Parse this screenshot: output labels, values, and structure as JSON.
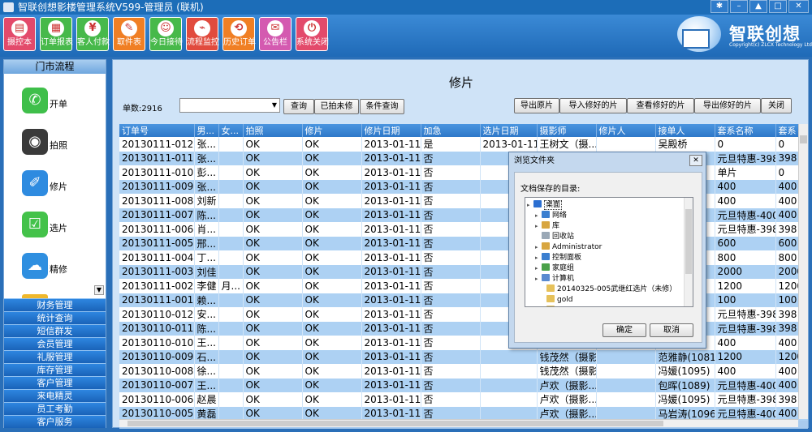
{
  "window": {
    "title": "智联创想影楼管理系统V599-管理员 (联机)",
    "controls": [
      "gear-icon",
      "minimize-icon",
      "shirt-icon",
      "restore-icon",
      "close-icon"
    ]
  },
  "toolbar": {
    "buttons": [
      {
        "label": "摄控本",
        "icon": "camera-book-icon",
        "color": "#e34a6b"
      },
      {
        "label": "订单报表",
        "icon": "report-icon",
        "color": "#47b94a"
      },
      {
        "label": "客人付款",
        "icon": "payment-icon",
        "color": "#47b94a"
      },
      {
        "label": "取件表",
        "icon": "pickup-icon",
        "color": "#f07f24"
      },
      {
        "label": "今日接待",
        "icon": "reception-icon",
        "color": "#47b94a"
      },
      {
        "label": "流程监控",
        "icon": "monitor-icon",
        "color": "#e14b3e"
      },
      {
        "label": "历史订单",
        "icon": "history-icon",
        "color": "#f07f24"
      },
      {
        "label": "公告栏",
        "icon": "notice-icon",
        "color": "#d45ab0"
      },
      {
        "label": "系统关闭",
        "icon": "shutdown-icon",
        "color": "#e34a6b"
      }
    ]
  },
  "brand": {
    "name": "智联创想",
    "subtitle": "Copyright(c) ZLCX Technology Ltd"
  },
  "sidebar": {
    "section_title": "门市流程",
    "tiles": [
      {
        "label": "开单",
        "icon": "phone-icon",
        "color": "#3fbf4a"
      },
      {
        "label": "拍照",
        "icon": "camera-icon",
        "color": "#3a3a3a"
      },
      {
        "label": "修片",
        "icon": "edit-photo-icon",
        "color": "#2e8be0"
      },
      {
        "label": "选片",
        "icon": "select-photo-icon",
        "color": "#44c24a"
      },
      {
        "label": "精修",
        "icon": "weather-icon",
        "color": "#2f8fe0"
      }
    ],
    "menu": [
      "财务管理",
      "统计查询",
      "短信群发",
      "会员管理",
      "礼服管理",
      "库存管理",
      "客户管理",
      "来电精灵",
      "员工考勤",
      "客户服务"
    ]
  },
  "main": {
    "title": "修片",
    "count_label": "单数:2916",
    "filter_value": "",
    "buttons": {
      "query": "查询",
      "shot_not_retouched": "已拍未修",
      "conditional_query": "条件查询",
      "export_originals": "导出原片",
      "import_retouched": "导入修好的片",
      "view_retouched": "查看修好的片",
      "export_retouched": "导出修好的片",
      "close": "关闭"
    }
  },
  "table": {
    "columns": [
      "订单号",
      "男...",
      "女...",
      "拍照",
      "修片",
      "修片日期",
      "加急",
      "选片日期",
      "摄影师",
      "修片人",
      "接单人",
      "套系名称",
      "套系"
    ],
    "rows": [
      [
        "20130111-012",
        "张...",
        "",
        "OK",
        "OK",
        "2013-01-11",
        "是",
        "2013-01-11",
        "王树文（摄...",
        "",
        "吴殿桥",
        "0",
        "0"
      ],
      [
        "20130111-011",
        "张...",
        "",
        "OK",
        "OK",
        "2013-01-11",
        "否",
        "",
        "",
        "",
        "",
        "元旦特惠-398",
        "398"
      ],
      [
        "20130111-010",
        "彭...",
        "",
        "OK",
        "OK",
        "2013-01-11",
        "否",
        "",
        "",
        "",
        "",
        "单片",
        "0"
      ],
      [
        "20130111-009",
        "张...",
        "",
        "OK",
        "OK",
        "2013-01-11",
        "否",
        "",
        "",
        "",
        "",
        "400",
        "400"
      ],
      [
        "20130111-008",
        "刘新",
        "",
        "OK",
        "OK",
        "2013-01-11",
        "否",
        "",
        "",
        "",
        "",
        "400",
        "400"
      ],
      [
        "20130111-007",
        "陈...",
        "",
        "OK",
        "OK",
        "2013-01-11",
        "否",
        "",
        "",
        "",
        "1)",
        "元旦特惠-400",
        "400"
      ],
      [
        "20130111-006",
        "肖...",
        "",
        "OK",
        "OK",
        "2013-01-11",
        "否",
        "",
        "",
        "",
        "2)",
        "元旦特惠-398",
        "398"
      ],
      [
        "20130111-005",
        "邢...",
        "",
        "OK",
        "OK",
        "2013-01-11",
        "否",
        "",
        "",
        "",
        "2)",
        "600",
        "600"
      ],
      [
        "20130111-004",
        "丁...",
        "",
        "OK",
        "OK",
        "2013-01-11",
        "否",
        "",
        "",
        "",
        "5)",
        "800",
        "800"
      ],
      [
        "20130111-003",
        "刘佳",
        "",
        "OK",
        "OK",
        "2013-01-11",
        "否",
        "",
        "",
        "",
        "",
        "2000",
        "2000"
      ],
      [
        "20130111-002",
        "李健",
        "月...",
        "OK",
        "OK",
        "2013-01-11",
        "否",
        "",
        "",
        "",
        "",
        "1200",
        "1200"
      ],
      [
        "20130111-001",
        "赖...",
        "",
        "OK",
        "OK",
        "2013-01-11",
        "否",
        "",
        "",
        "",
        "5)",
        "100",
        "100"
      ],
      [
        "20130110-012",
        "安...",
        "",
        "OK",
        "OK",
        "2013-01-11",
        "否",
        "",
        "",
        "",
        "5)",
        "元旦特惠-398",
        "398"
      ],
      [
        "20130110-011",
        "陈...",
        "",
        "OK",
        "OK",
        "2013-01-11",
        "否",
        "",
        "",
        "",
        "2)",
        "元旦特惠-398",
        "398"
      ],
      [
        "20130110-010",
        "王...",
        "",
        "OK",
        "OK",
        "2013-01-11",
        "否",
        "",
        "",
        "",
        "",
        "400",
        "400"
      ],
      [
        "20130110-009",
        "石...",
        "",
        "OK",
        "OK",
        "2013-01-11",
        "否",
        "",
        "钱茂然（摄影...",
        "",
        "范雅静(1081)",
        "1200",
        "1200"
      ],
      [
        "20130110-008",
        "徐...",
        "",
        "OK",
        "OK",
        "2013-01-11",
        "否",
        "",
        "钱茂然（摄影...",
        "",
        "冯媛(1095)",
        "400",
        "400"
      ],
      [
        "20130110-007",
        "王...",
        "",
        "OK",
        "OK",
        "2013-01-11",
        "否",
        "",
        "卢欢（摄影...",
        "",
        "包晖(1089)",
        "元旦特惠-400",
        "400"
      ],
      [
        "20130110-006",
        "赵晨",
        "",
        "OK",
        "OK",
        "2013-01-11",
        "否",
        "",
        "卢欢（摄影...",
        "",
        "冯媛(1095)",
        "元旦特惠-398",
        "398"
      ],
      [
        "20130110-005",
        "黄磊",
        "",
        "OK",
        "OK",
        "2013-01-11",
        "否",
        "",
        "卢欢（摄影...",
        "",
        "马岩涛(1096)",
        "元旦特惠-400",
        "400"
      ]
    ]
  },
  "dialog": {
    "title": "浏览文件夹",
    "prompt": "文档保存的目录:",
    "tree": [
      {
        "label": "桌面",
        "icon": "desktop-icon",
        "color": "#2c6fd1",
        "selected": true
      },
      {
        "label": "网络",
        "icon": "network-icon",
        "color": "#3b7fd0"
      },
      {
        "label": "库",
        "icon": "library-icon",
        "color": "#d8a640"
      },
      {
        "label": "回收站",
        "icon": "recycle-bin-icon",
        "color": "#9aa8b6"
      },
      {
        "label": "Administrator",
        "icon": "user-folder-icon",
        "color": "#d8a640"
      },
      {
        "label": "控制面板",
        "icon": "control-panel-icon",
        "color": "#3b7fd0"
      },
      {
        "label": "家庭组",
        "icon": "homegroup-icon",
        "color": "#4aa14a"
      },
      {
        "label": "计算机",
        "icon": "computer-icon",
        "color": "#5a8ad0"
      },
      {
        "label": "20140325-005武继红选片（未修）",
        "icon": "folder-icon",
        "color": "#e6c15a"
      },
      {
        "label": "gold",
        "icon": "folder-icon",
        "color": "#e6c15a"
      },
      {
        "label": "",
        "icon": "folder-icon",
        "color": "#e6c15a"
      }
    ],
    "ok": "确定",
    "cancel": "取消"
  }
}
